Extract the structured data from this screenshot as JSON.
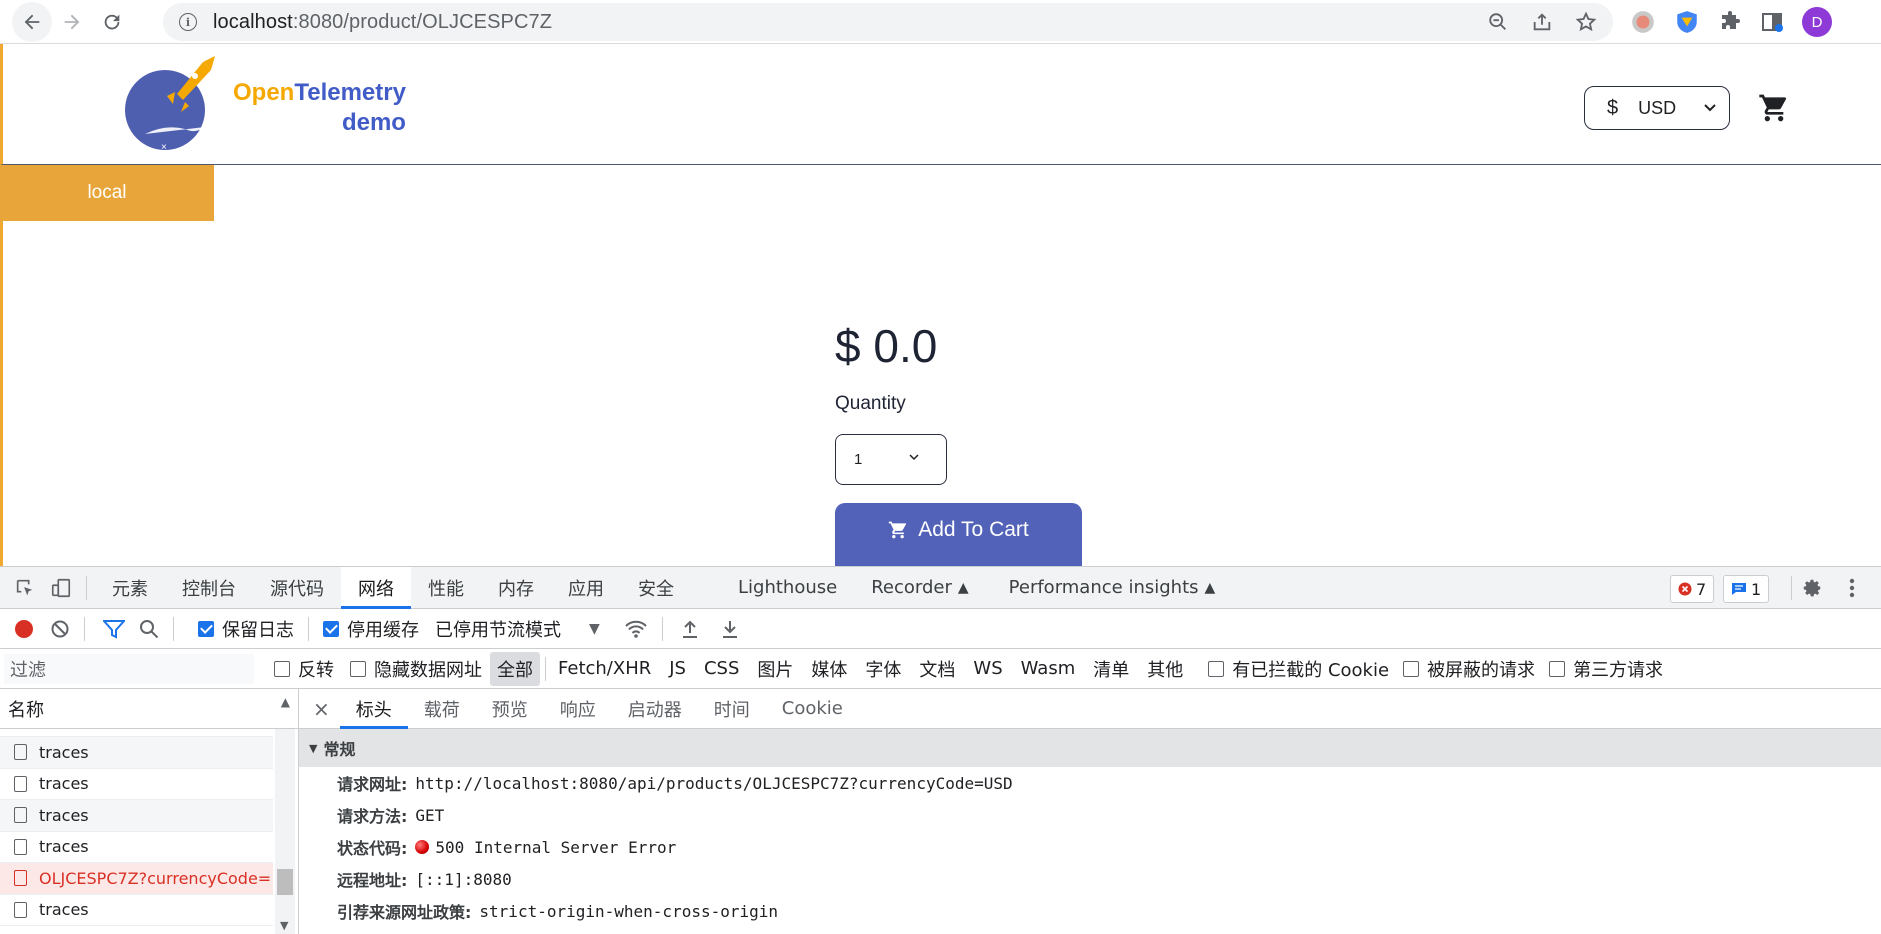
{
  "browser": {
    "url_host": "localhost",
    "url_path": ":8080/product/OLJCESPC7Z",
    "avatar_initial": "D"
  },
  "site": {
    "logo_open": "Open",
    "logo_telemetry": "Telemetry",
    "logo_demo": "demo",
    "currency_symbol": "$",
    "currency_code": "USD",
    "banner": "local",
    "price": "$ 0.0",
    "quantity_label": "Quantity",
    "quantity_value": "1",
    "add_to_cart": "Add To Cart"
  },
  "devtools": {
    "tabs": [
      "元素",
      "控制台",
      "源代码",
      "网络",
      "性能",
      "内存",
      "应用",
      "安全",
      "Lighthouse",
      "Recorder",
      "Performance insights"
    ],
    "active_tab": "网络",
    "error_count": "7",
    "message_count": "1",
    "toolbar": {
      "preserve_log": "保留日志",
      "disable_cache": "停用缓存",
      "throttling": "已停用节流模式"
    },
    "filter": {
      "placeholder": "过滤",
      "invert": "反转",
      "hide_data_urls": "隐藏数据网址",
      "types": [
        "全部",
        "Fetch/XHR",
        "JS",
        "CSS",
        "图片",
        "媒体",
        "字体",
        "文档",
        "WS",
        "Wasm",
        "清单",
        "其他"
      ],
      "blocked_cookies": "有已拦截的 Cookie",
      "blocked_requests": "被屏蔽的请求",
      "third_party": "第三方请求"
    },
    "requests": {
      "header": "名称",
      "rows": [
        "traces",
        "traces",
        "traces",
        "traces",
        "OLJCESPC7Z?currencyCode=",
        "traces"
      ]
    },
    "detail": {
      "close": "×",
      "tabs": [
        "标头",
        "载荷",
        "预览",
        "响应",
        "启动器",
        "时间",
        "Cookie"
      ],
      "section": "常规",
      "request_url_label": "请求网址:",
      "request_url": "http://localhost:8080/api/products/OLJCESPC7Z?currencyCode=USD",
      "method_label": "请求方法:",
      "method": "GET",
      "status_label": "状态代码:",
      "status": "500 Internal Server Error",
      "remote_label": "远程地址:",
      "remote": "[::1]:8080",
      "referrer_label": "引荐来源网址政策:",
      "referrer": "strict-origin-when-cross-origin"
    }
  }
}
